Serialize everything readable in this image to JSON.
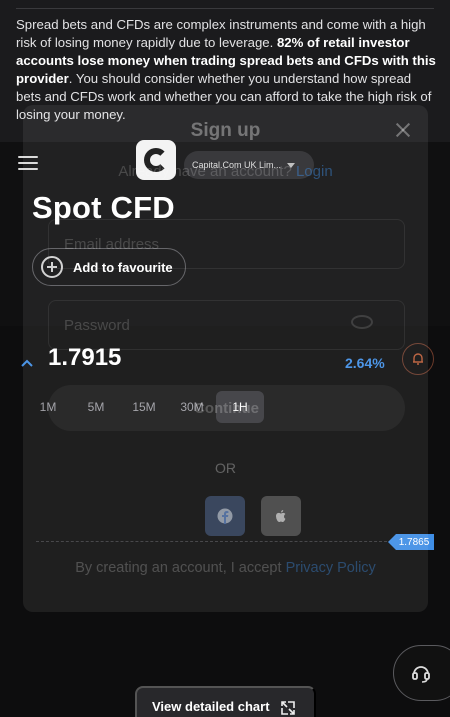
{
  "risk_banner": {
    "text_start": "Spread bets and CFDs are complex instruments and come with a high risk of losing money rapidly due to leverage. ",
    "text_bold": "82% of retail investor accounts lose money when trading spread bets and CFDs with this provider",
    "text_end": ". You should consider whether you understand how spread bets and CFDs work and whether you can afford to take the high risk of losing your money."
  },
  "header": {
    "menu_icon": "hamburger-menu-icon",
    "logo_icon": "capital-com-logo-icon",
    "entity_select": "Capital.Com UK Lim..."
  },
  "instrument": {
    "title": "Spot CFD",
    "favourite_label": "Add to favourite",
    "price": "1.7915",
    "change": "2.64%",
    "change_color": "#3f8ee6",
    "direction_icon": "chevron-up-icon",
    "alert_icon": "bell-icon"
  },
  "timeframes": [
    "1M",
    "5M",
    "15M",
    "30M",
    "1H"
  ],
  "active_timeframe": "1H",
  "chart": {
    "price_tag": "1.7865"
  },
  "support_icon": "headset-icon",
  "detailed_chart_label": "View detailed chart",
  "signup_modal": {
    "title": "Sign up",
    "have_account": "Already have an account?",
    "login_link": "Login",
    "email_placeholder": "Email address",
    "password_placeholder": "Password",
    "continue_label": "Continue",
    "or_label": "OR",
    "terms_text": "By creating an account, I accept",
    "privacy_link": "Privacy Policy"
  },
  "colors": {
    "accent": "#3f8ee6",
    "background": "#0d0d0e",
    "banner": "#1b1b1d"
  }
}
